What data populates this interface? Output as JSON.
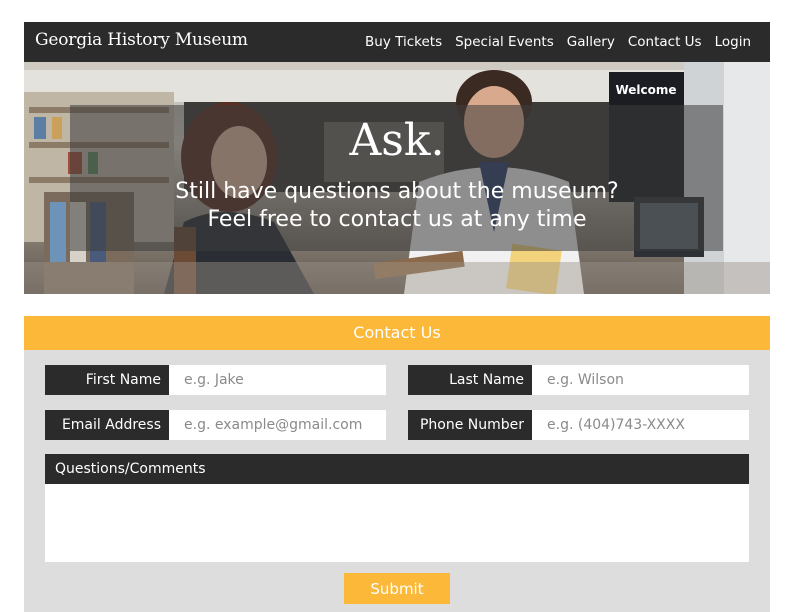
{
  "nav": {
    "brand": "Georgia History Museum",
    "links": [
      "Buy Tickets",
      "Special Events",
      "Gallery",
      "Contact Us",
      "Login"
    ]
  },
  "hero": {
    "title": "Ask.",
    "subtitle_line1": "Still have questions about the museum?",
    "subtitle_line2": "Feel free to contact us at any time",
    "welcome_sign": "Welcome"
  },
  "form": {
    "header": "Contact Us",
    "first_name": {
      "label": "First Name",
      "placeholder": "e.g. Jake"
    },
    "last_name": {
      "label": "Last Name",
      "placeholder": "e.g. Wilson"
    },
    "email": {
      "label": "Email Address",
      "placeholder": "e.g. example@gmail.com"
    },
    "phone": {
      "label": "Phone Number",
      "placeholder": "e.g. (404)743-XXXX"
    },
    "comments_label": "Questions/Comments",
    "submit_label": "Submit"
  },
  "colors": {
    "accent": "#fcb838",
    "dark": "#2b2b2b",
    "panel": "#dddddd"
  }
}
